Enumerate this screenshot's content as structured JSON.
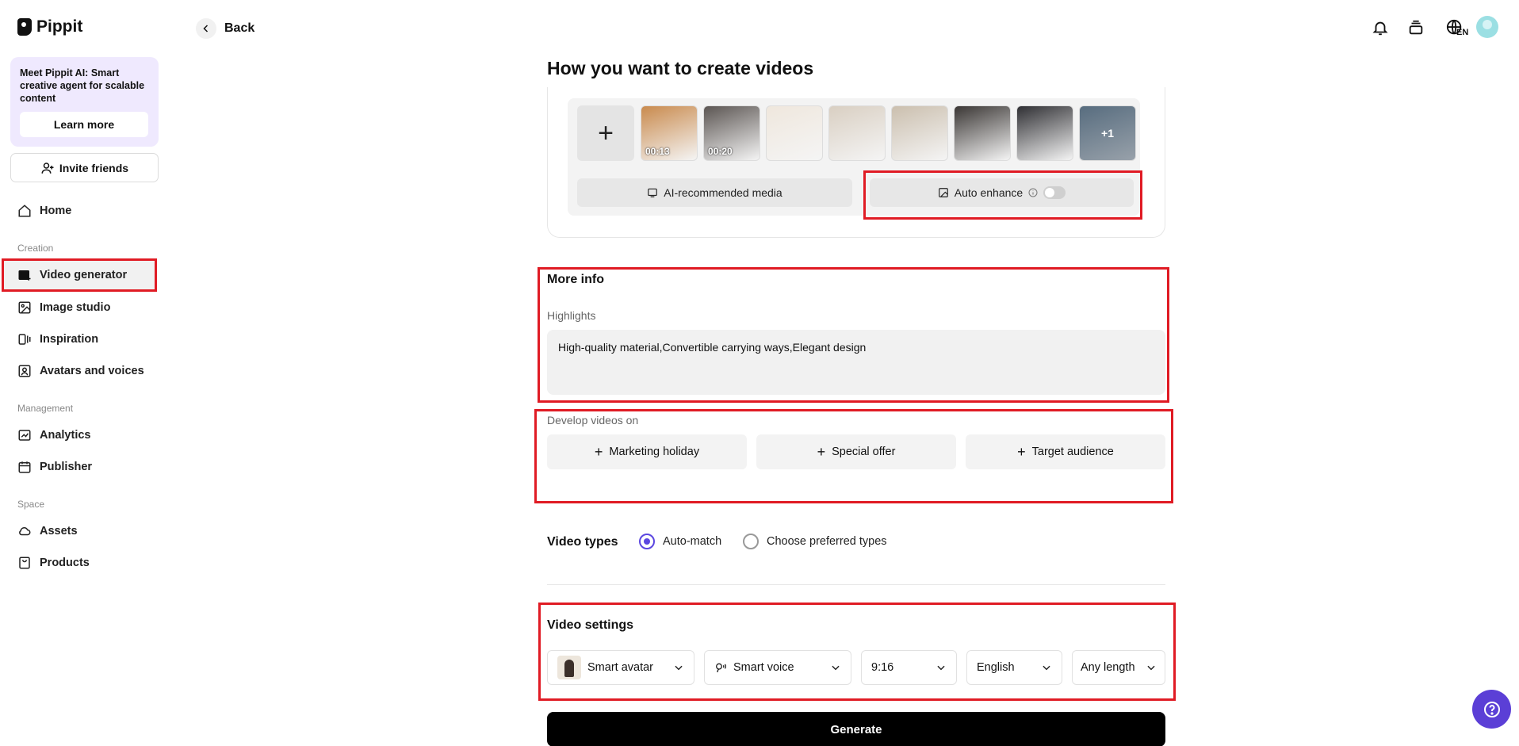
{
  "app": {
    "name": "Pippit"
  },
  "sidebar": {
    "promo": {
      "text": "Meet Pippit AI: Smart creative agent for scalable content",
      "button": "Learn more"
    },
    "invite": "Invite friends",
    "home": "Home",
    "sections": {
      "creation": "Creation",
      "management": "Management",
      "space": "Space"
    },
    "items": {
      "video_generator": "Video generator",
      "image_studio": "Image studio",
      "inspiration": "Inspiration",
      "avatars_voices": "Avatars and voices",
      "analytics": "Analytics",
      "publisher": "Publisher",
      "assets": "Assets",
      "products": "Products"
    }
  },
  "header": {
    "back": "Back",
    "language": "EN"
  },
  "main": {
    "title": "How you want to create videos",
    "media": {
      "thumbs": [
        {
          "duration": "00:13",
          "color": "#c98a4d"
        },
        {
          "duration": "00:20",
          "color": "#5b5552"
        },
        {
          "duration": "",
          "color": "#efe7dd"
        },
        {
          "duration": "",
          "color": "#d9cfc2"
        },
        {
          "duration": "",
          "color": "#cbbfae"
        },
        {
          "duration": "",
          "color": "#3a3634"
        },
        {
          "duration": "",
          "color": "#2f2f33"
        },
        {
          "duration": "",
          "color": "#7f95a6",
          "more": "+1"
        }
      ],
      "ai_recommended": "AI-recommended media",
      "auto_enhance": "Auto enhance"
    },
    "more_info": {
      "title": "More info",
      "highlights_label": "Highlights",
      "highlights_value": "High-quality material,Convertible carrying ways,Elegant design"
    },
    "develop": {
      "label": "Develop videos on",
      "chips": [
        "Marketing holiday",
        "Special offer",
        "Target audience"
      ]
    },
    "video_types": {
      "label": "Video types",
      "options": [
        "Auto-match",
        "Choose preferred types"
      ],
      "selected": "Auto-match"
    },
    "video_settings": {
      "title": "Video settings",
      "avatar": "Smart avatar",
      "voice": "Smart voice",
      "ratio": "9:16",
      "language": "English",
      "length": "Any length"
    },
    "generate": "Generate"
  },
  "colors": {
    "accent": "#5b47e0",
    "highlight": "#e01b24",
    "promo_bg": "#efe9fe"
  }
}
